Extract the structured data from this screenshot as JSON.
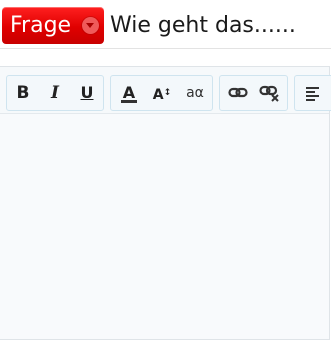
{
  "title_row": {
    "category_badge": "Frage",
    "title_value": "Wie geht das......"
  },
  "toolbar": {
    "bold": "B",
    "italic": "I",
    "underline": "U",
    "font_color": "A",
    "font_size": "A",
    "font_size_mark": "↕",
    "remove_format": "aα"
  },
  "editor": {
    "content": ""
  }
}
